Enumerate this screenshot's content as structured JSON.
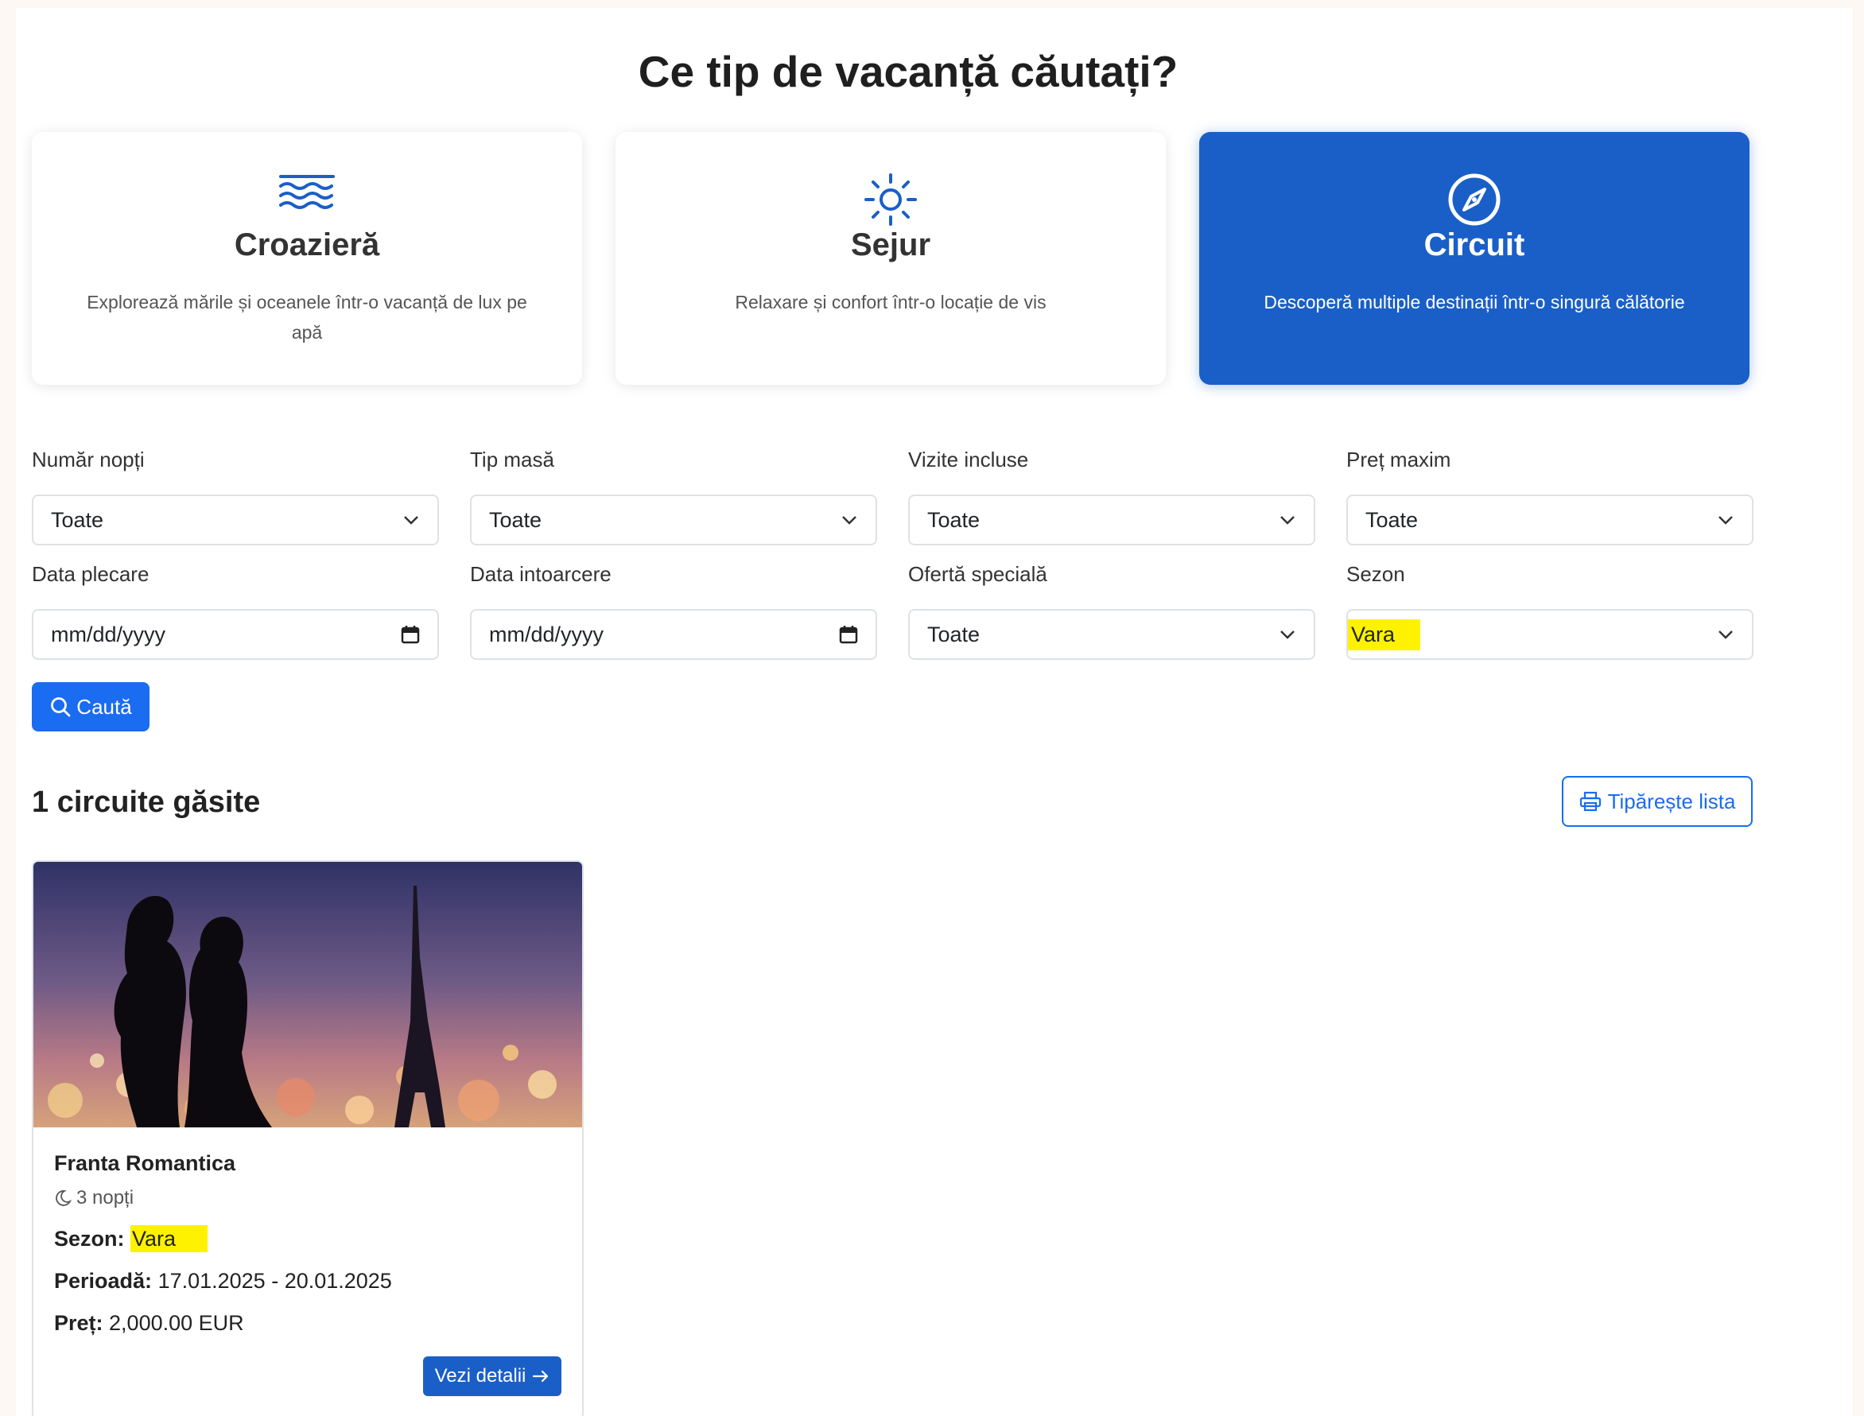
{
  "heading": "Ce tip de vacanță căutați?",
  "vacation_types": [
    {
      "icon": "waves-icon",
      "title": "Croazieră",
      "description": "Explorează mările și oceanele într-o vacanță de lux pe apă",
      "active": false
    },
    {
      "icon": "sun-icon",
      "title": "Sejur",
      "description": "Relaxare și confort într-o locație de vis",
      "active": false
    },
    {
      "icon": "compass-icon",
      "title": "Circuit",
      "description": "Descoperă multiple destinații într-o singură călătorie",
      "active": true
    }
  ],
  "filters": {
    "nopti": {
      "label": "Număr nopți",
      "value": "Toate"
    },
    "masa": {
      "label": "Tip masă",
      "value": "Toate"
    },
    "vizite": {
      "label": "Vizite incluse",
      "value": "Toate"
    },
    "pret": {
      "label": "Preț maxim",
      "value": "Toate"
    },
    "plecare": {
      "label": "Data plecare",
      "value": "mm/dd/yyyy"
    },
    "intoarcere": {
      "label": "Data intoarcere",
      "value": "mm/dd/yyyy"
    },
    "oferta": {
      "label": "Ofertă specială",
      "value": "Toate"
    },
    "sezon": {
      "label": "Sezon",
      "value": "Vara"
    }
  },
  "search_button": "Caută",
  "results_title": "1 circuite găsite",
  "print_button": "Tipărește lista",
  "result": {
    "name": "Franta Romantica",
    "nights": "3 nopți",
    "season_label": "Sezon:",
    "season_value": "Vara",
    "period_label": "Perioadă:",
    "period_value": "17.01.2025 - 20.01.2025",
    "price_label": "Preț:",
    "price_value": "2,000.00 EUR",
    "details_button": "Vezi detalii"
  },
  "colors": {
    "primary": "#1a6cf0",
    "active_card": "#1a5fc7",
    "highlight": "#fff200"
  }
}
